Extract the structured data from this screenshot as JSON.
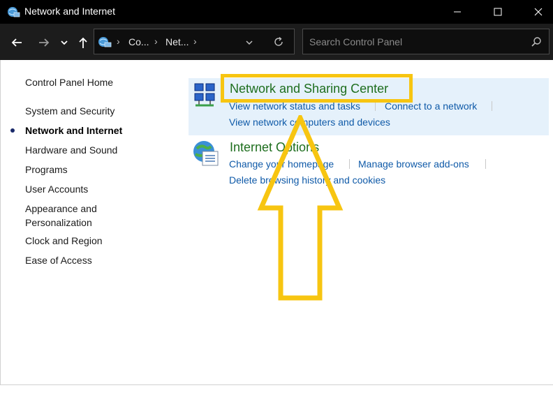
{
  "window": {
    "title": "Network and Internet"
  },
  "address": {
    "crumbs": [
      "Co...",
      "Net..."
    ]
  },
  "search": {
    "placeholder": "Search Control Panel"
  },
  "sidebar": {
    "home": "Control Panel Home",
    "items": [
      {
        "label": "System and Security"
      },
      {
        "label": "Network and Internet",
        "active": true
      },
      {
        "label": "Hardware and Sound"
      },
      {
        "label": "Programs"
      },
      {
        "label": "User Accounts"
      },
      {
        "label": "Appearance and"
      },
      {
        "label": "Personalization"
      },
      {
        "label": "Clock and Region"
      },
      {
        "label": "Ease of Access"
      }
    ]
  },
  "categories": [
    {
      "title": "Network and Sharing Center",
      "tasks": [
        "View network status and tasks",
        "Connect to a network",
        "View network computers and devices"
      ]
    },
    {
      "title": "Internet Options",
      "tasks": [
        "Change your homepage",
        "Manage browser add-ons",
        "Delete browsing history and cookies"
      ]
    }
  ],
  "colors": {
    "titlebar": "#000000",
    "addressbar": "#1c1c1c",
    "link": "#0f5aa8",
    "category_title": "#1e6e1e",
    "highlight_bg": "#e5f1fb",
    "annotation": "#f7c511"
  }
}
